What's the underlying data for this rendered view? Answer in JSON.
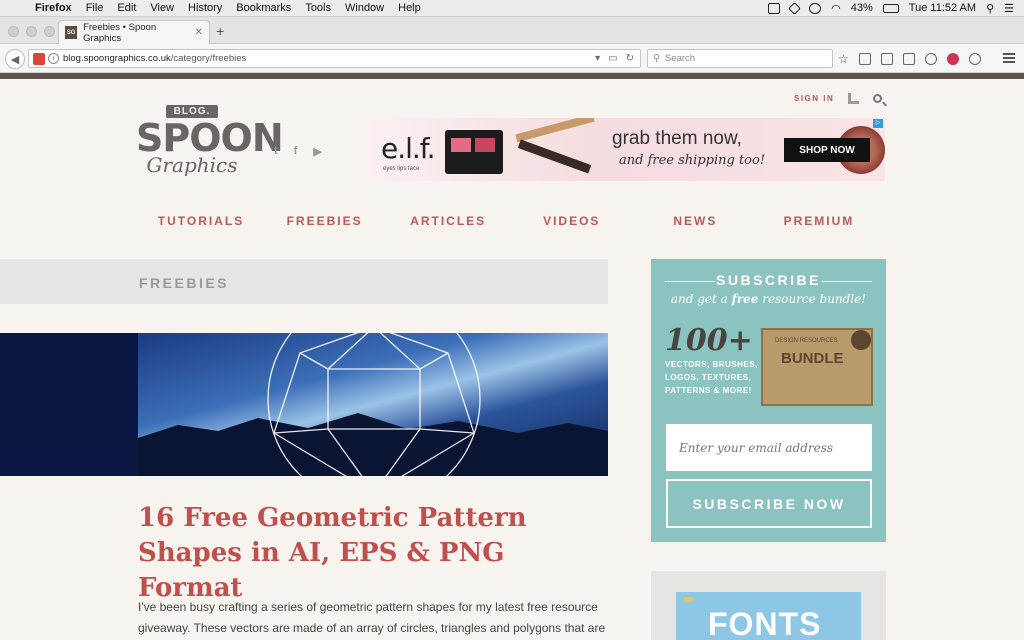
{
  "menubar": {
    "apple": "",
    "items": [
      "Firefox",
      "File",
      "Edit",
      "View",
      "History",
      "Bookmarks",
      "Tools",
      "Window",
      "Help"
    ],
    "battery": "43%",
    "clock": "Tue 11:52 AM"
  },
  "browser": {
    "tab_title": "Freebies • Spoon Graphics",
    "tab_favicon": "SG",
    "url_host": "blog.spoongraphics.co.uk",
    "url_path": "/category/freebies",
    "search_placeholder": "Search"
  },
  "site": {
    "signin": "SIGN IN",
    "logo": {
      "blog": "BLOG.",
      "spoon": "SPOON",
      "graphics": "Graphics"
    },
    "social": [
      "t",
      "f",
      "▶"
    ],
    "ad": {
      "brand": "e.l.f.",
      "brand_sub": "eyes lips face",
      "headline": "grab them now,",
      "subline": "and free shipping too!",
      "cta": "SHOP NOW"
    },
    "nav": [
      "TUTORIALS",
      "FREEBIES",
      "ARTICLES",
      "VIDEOS",
      "NEWS",
      "PREMIUM"
    ],
    "section_title": "FREEBIES",
    "post": {
      "title": "16 Free Geometric Pattern Shapes in AI, EPS & PNG Format",
      "excerpt": "I've been busy crafting a series of geometric pattern shapes for my latest free resource giveaway. These vectors are made of an array of circles, triangles and polygons that are"
    },
    "subscribe": {
      "heading": "SUBSCRIBE",
      "tag_pre": "and get a ",
      "tag_free": "free",
      "tag_post": " resource bundle!",
      "big": "100+",
      "list": "VECTORS, BRUSHES, LOGOS, TEXTURES, PATTERNS & MORE!",
      "crate_label": "BUNDLE",
      "crate_sub": "DESIGN RESOURCES",
      "email_placeholder": "Enter your email address",
      "button": "SUBSCRIBE NOW"
    },
    "fonts_promo": "FONTS"
  }
}
